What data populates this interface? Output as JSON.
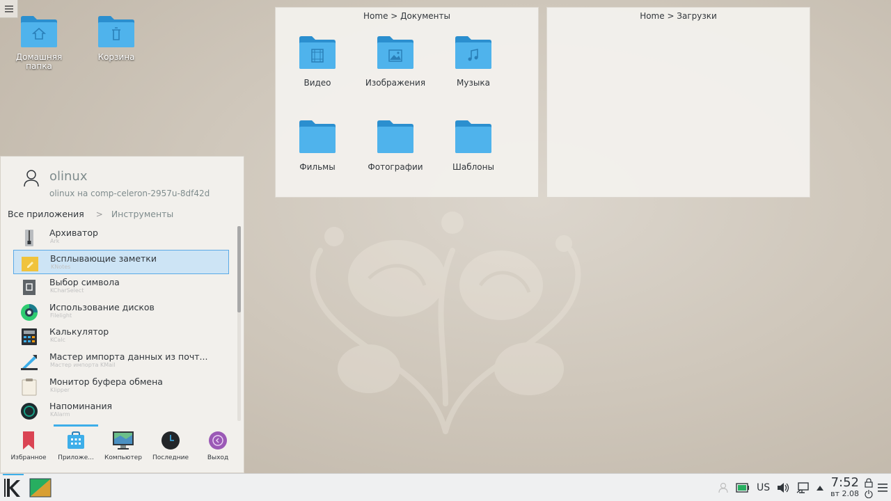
{
  "desktop": {
    "icons": [
      {
        "label": "Домашняя папка",
        "icon": "home-folder-icon"
      },
      {
        "label": "Корзина",
        "icon": "trash-folder-icon"
      }
    ]
  },
  "folderviews": [
    {
      "title": "Home > Документы",
      "items": [
        {
          "label": "Видео",
          "icon": "video-folder-icon"
        },
        {
          "label": "Изображения",
          "icon": "pictures-folder-icon"
        },
        {
          "label": "Музыка",
          "icon": "music-folder-icon"
        },
        {
          "label": "Фильмы",
          "icon": "folder-icon"
        },
        {
          "label": "Фотографии",
          "icon": "folder-icon"
        },
        {
          "label": "Шаблоны",
          "icon": "folder-icon"
        }
      ]
    },
    {
      "title": "Home > Загрузки",
      "items": []
    }
  ],
  "launcher": {
    "user": {
      "name": "olinux",
      "host": "olinux на comp-celeron-2957u-8df42d"
    },
    "breadcrumb": {
      "root": "Все приложения",
      "separator": ">",
      "current": "Инструменты"
    },
    "apps": [
      {
        "name": "Архиватор",
        "sub": "Ark"
      },
      {
        "name": "Всплывающие заметки",
        "sub": "KNotes"
      },
      {
        "name": "Выбор символа",
        "sub": "KCharSelect"
      },
      {
        "name": "Использование дисков",
        "sub": "Filelight"
      },
      {
        "name": "Калькулятор",
        "sub": "KCalc"
      },
      {
        "name": "Мастер импорта данных из почт...",
        "sub": "Мастер импорта KMail"
      },
      {
        "name": "Монитор буфера обмена",
        "sub": "Klipper"
      },
      {
        "name": "Напоминания",
        "sub": "KAlarm"
      }
    ],
    "tabs": [
      {
        "label": "Избранное",
        "icon": "bookmark-icon"
      },
      {
        "label": "Приложе...",
        "icon": "applications-icon"
      },
      {
        "label": "Компьютер",
        "icon": "computer-icon"
      },
      {
        "label": "Последние",
        "icon": "clock-icon"
      },
      {
        "label": "Выход",
        "icon": "logout-icon"
      }
    ]
  },
  "taskbar": {
    "keyboard_layout": "US",
    "time": "7:52",
    "date": "вт 2.08"
  },
  "colors": {
    "accent": "#3daee9",
    "folder": "#3daee9",
    "highlight_bg": "#cde4f5"
  }
}
